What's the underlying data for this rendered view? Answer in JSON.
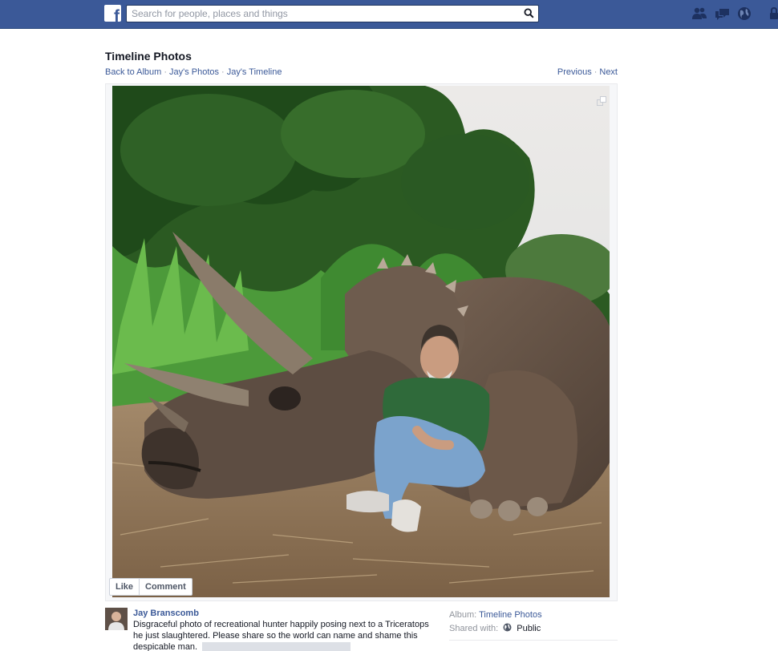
{
  "topbar": {
    "logo": "f",
    "search_placeholder": "Search for people, places and things",
    "icons": [
      "friend-requests-icon",
      "messages-icon",
      "notifications-globe-icon"
    ]
  },
  "page": {
    "title": "Timeline Photos",
    "breadcrumbs": [
      "Back to Album",
      "Jay's Photos",
      "Jay's Timeline"
    ],
    "pager": {
      "previous": "Previous",
      "next": "Next"
    }
  },
  "photo_actions": {
    "like": "Like",
    "comment": "Comment"
  },
  "post": {
    "author": "Jay Branscomb",
    "caption": "Disgraceful photo of recreational hunter happily posing next to a Triceratops he just slaughtered. Please share so the world can name and shame this despicable man."
  },
  "meta": {
    "album_label": "Album:",
    "album_value": "Timeline Photos",
    "shared_label": "Shared with:",
    "shared_value": "Public"
  },
  "colors": {
    "brand": "#3b5998",
    "link": "#3b5998",
    "text": "#141823"
  }
}
